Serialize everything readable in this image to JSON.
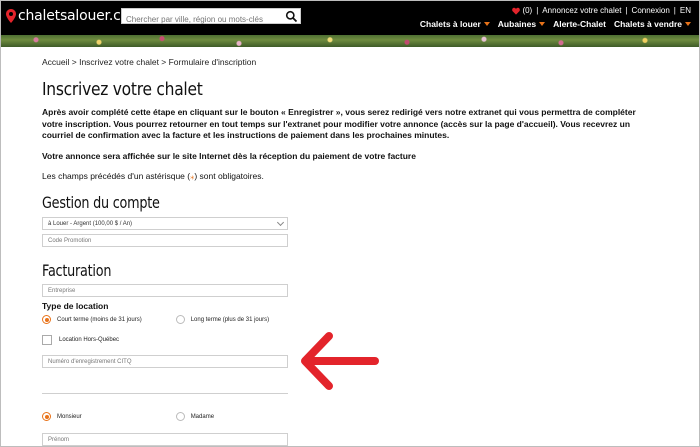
{
  "header": {
    "logo_text": "chaletsalouer.com",
    "search_placeholder": "Chercher par ville, région ou mots-clés",
    "favorites_count": "(0)",
    "announce_link": "Annoncez votre chalet",
    "login_link": "Connexion",
    "lang_link": "EN",
    "nav": [
      {
        "label": "Chalets à louer"
      },
      {
        "label": "Aubaines"
      },
      {
        "label": "Alerte-Chalet"
      },
      {
        "label": "Chalets à vendre"
      }
    ]
  },
  "breadcrumb": "Accueil > Inscrivez votre chalet > Formulaire d'inscription",
  "page_title": "Inscrivez votre chalet",
  "intro_text": "Après avoir complété cette étape en cliquant sur le bouton « Enregistrer », vous serez redirigé vers notre extranet qui vous permettra de compléter votre inscription. Vous pourrez retourner en tout temps sur l'extranet pour modifier votre annonce (accès sur la page d'accueil). Vous recevrez un courriel de confirmation avec la facture et les instructions de paiement dans les prochaines minutes.",
  "notice_text": "Votre annonce sera affichée sur le site Internet dès la réception du paiement de votre facture",
  "required_note": {
    "before": "Les champs précédés d'un astérisque (",
    "mark": "⁎",
    "after": ") sont obligatoires."
  },
  "account_section": {
    "title": "Gestion du compte",
    "plan_select_value": "à Louer - Argent (100,00 $ / An)",
    "promo_placeholder": "Code Promotion"
  },
  "billing_section": {
    "title": "Facturation",
    "company_placeholder": "Entreprise",
    "rental_type_label": "Type de location",
    "rental_options": [
      {
        "label": "Court terme (moins de 31 jours)",
        "checked": true
      },
      {
        "label": "Long terme (plus de 31 jours)",
        "checked": false
      }
    ],
    "outside_quebec_label": "Location Hors-Québec",
    "citq_placeholder": "Numéro d'enregistrement CITQ",
    "title_options": [
      {
        "label": "Monsieur",
        "checked": true
      },
      {
        "label": "Madame",
        "checked": false
      }
    ],
    "firstname_placeholder": "Prénom"
  },
  "colors": {
    "accent": "#e8731a",
    "arrow": "#e3242b",
    "header_bg": "#000000"
  }
}
